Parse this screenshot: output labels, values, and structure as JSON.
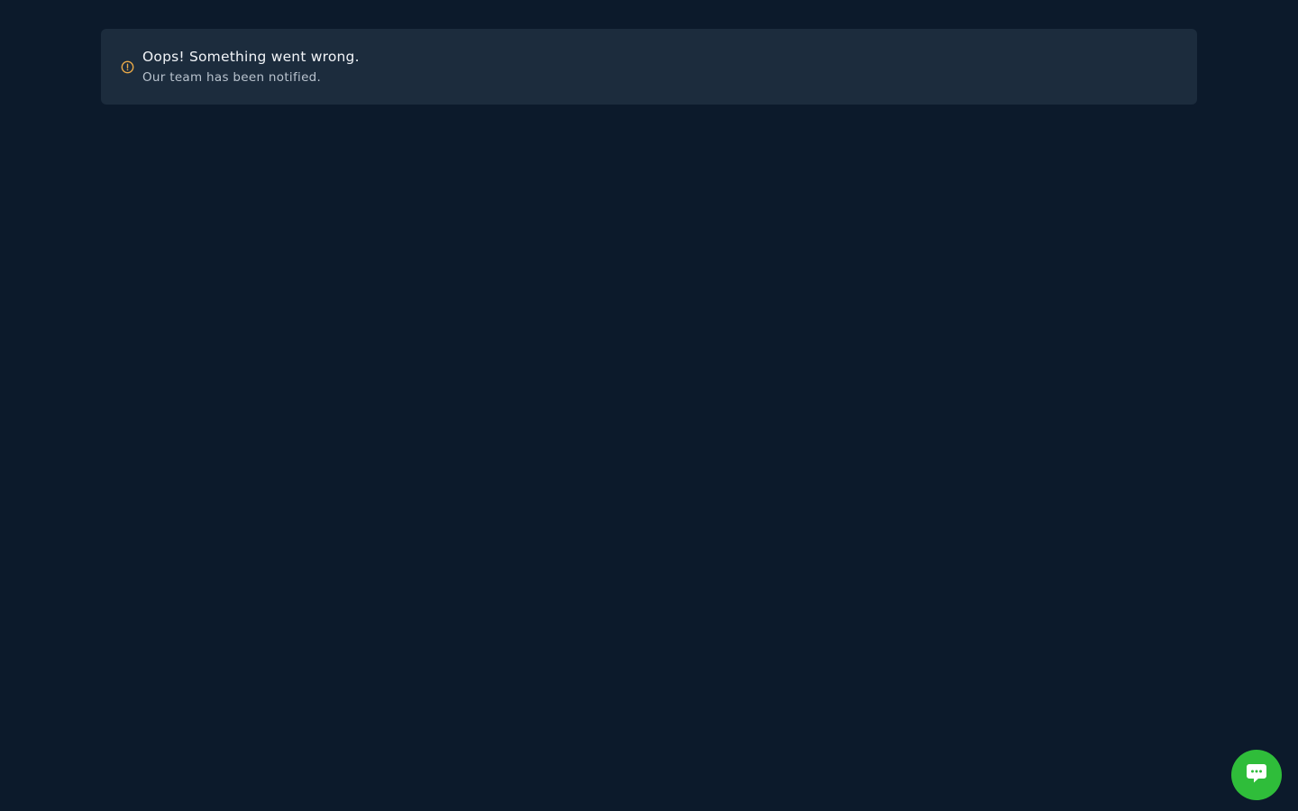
{
  "alert": {
    "icon": "warning-circle-icon",
    "icon_color": "#e9a948",
    "title": "Oops! Something went wrong.",
    "subtitle": "Our team has been notified."
  },
  "chat_widget": {
    "icon": "chat-bubble-icon",
    "color": "#2fbd3a"
  },
  "colors": {
    "background": "#0c1a2b",
    "alert_background": "#1c2c3d"
  }
}
